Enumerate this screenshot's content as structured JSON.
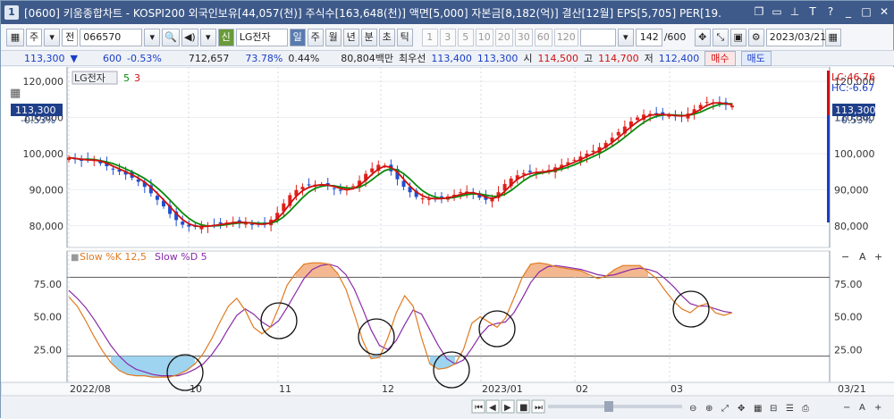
{
  "window": {
    "number": "1",
    "title": "[0600] 키움종합차트 - KOSPI200 외국인보유[44,057(천)] 주식수[163,648(천)] 액면[5,000] 자본금[8,182(억)] 결산[12월] EPS[5,705] PER[19.",
    "icons": [
      "restore-icon",
      "minimize-icon",
      "pin-icon",
      "text-icon",
      "help-icon",
      "min-icon",
      "max-icon",
      "close-icon"
    ]
  },
  "toolbar": {
    "period": "주",
    "before": "전",
    "code": "066570",
    "stock_kind": "신",
    "stock_name": "LG전자",
    "timeframes": [
      "일",
      "주",
      "월",
      "년",
      "분",
      "초",
      "틱"
    ],
    "active_timeframe": "일",
    "intervals": [
      "1",
      "3",
      "5",
      "10",
      "20",
      "30",
      "60",
      "120"
    ],
    "count": "142",
    "count_total": "/600",
    "date": "2023/03/21"
  },
  "quote": {
    "price": "113,300",
    "change": "600",
    "change_rate": "-0.53%",
    "volume": "712,657",
    "volume_rate": "73.78%",
    "turnover": "0.44%",
    "amount": "80,804백만",
    "best_label": "최우선",
    "best_ask": "113,400",
    "best_bid": "113,300",
    "open_label": "시",
    "open": "114,500",
    "high_label": "고",
    "high": "114,700",
    "low_label": "저",
    "low": "112,400",
    "buy_label": "매수",
    "sell_label": "매도"
  },
  "price_panel": {
    "legend_name": "LG전자",
    "ma_periods": [
      "5",
      "3"
    ],
    "current_price": "113,300",
    "current_rate": "-0.53%",
    "lc_label": "LC:46.76",
    "hc_label": "HC:-6.67"
  },
  "stoch_panel": {
    "legend_k": "Slow %K 12,5",
    "legend_d": "Slow %D 5"
  },
  "chart_data": [
    {
      "type": "candlestick",
      "title": "",
      "ylim": [
        74000,
        124000
      ],
      "yticks": [
        "80,000",
        "90,000",
        "100,000",
        "110,000",
        "120,000"
      ],
      "close": [
        98900,
        98400,
        98000,
        98400,
        98200,
        97300,
        96500,
        95800,
        95000,
        94200,
        93300,
        92200,
        90800,
        89000,
        87200,
        85400,
        83300,
        81600,
        80300,
        79800,
        79700,
        79900,
        80100,
        80300,
        80600,
        80900,
        81100,
        81000,
        80700,
        80400,
        80300,
        80600,
        81700,
        83600,
        86200,
        88500,
        89900,
        90800,
        91300,
        91400,
        91400,
        91100,
        90200,
        89700,
        90100,
        91000,
        92500,
        94400,
        95900,
        96900,
        96700,
        95100,
        92900,
        90800,
        89300,
        88000,
        87600,
        87400,
        87500,
        87700,
        88100,
        88600,
        89300,
        89500,
        88800,
        87800,
        87200,
        87700,
        89300,
        91600,
        93100,
        94000,
        94600,
        94900,
        94900,
        95000,
        95500,
        96200,
        96900,
        97600,
        98300,
        99200,
        100000,
        100800,
        101800,
        103000,
        104400,
        106000,
        107500,
        108900,
        110000,
        110800,
        111000,
        110800,
        110700,
        110600,
        110300,
        110400,
        111100,
        112300,
        113500,
        114300,
        114200,
        113800,
        113500,
        113300
      ],
      "ma_fast_name": "5",
      "ma_slow_name": "3"
    },
    {
      "type": "line",
      "title": "",
      "ylim": [
        0,
        100
      ],
      "yticks": [
        "25.00",
        "50.00",
        "75.00"
      ],
      "reference_lines": [
        80,
        20
      ],
      "series": [
        {
          "name": "Slow %K 12,5",
          "color": "#e07a1f",
          "values": [
            65,
            58,
            47,
            35,
            24,
            15,
            9,
            6,
            5,
            5,
            4,
            4,
            4,
            6,
            9,
            14,
            22,
            33,
            46,
            58,
            64,
            55,
            42,
            37,
            42,
            57,
            74,
            83,
            90,
            91,
            91,
            90,
            83,
            71,
            52,
            32,
            18,
            19,
            34,
            53,
            66,
            58,
            34,
            14,
            10,
            11,
            14,
            25,
            45,
            50,
            46,
            42,
            49,
            64,
            80,
            90,
            91,
            90,
            88,
            87,
            86,
            85,
            82,
            79,
            81,
            86,
            89,
            89,
            89,
            84,
            79,
            70,
            62,
            56,
            53,
            58,
            60,
            53,
            51,
            53
          ]
        },
        {
          "name": "Slow %D 5",
          "color": "#8a2aa8",
          "values": [
            70,
            64,
            57,
            48,
            38,
            28,
            20,
            14,
            10,
            8,
            6,
            5,
            5,
            5,
            7,
            10,
            14,
            21,
            30,
            41,
            51,
            56,
            52,
            46,
            42,
            47,
            57,
            68,
            79,
            86,
            89,
            90,
            88,
            82,
            71,
            56,
            40,
            28,
            25,
            32,
            44,
            55,
            52,
            40,
            28,
            18,
            14,
            17,
            26,
            36,
            43,
            45,
            46,
            53,
            64,
            76,
            84,
            88,
            89,
            88,
            87,
            86,
            84,
            82,
            81,
            82,
            84,
            86,
            87,
            86,
            84,
            79,
            73,
            66,
            60,
            58,
            58,
            56,
            54,
            53
          ]
        }
      ]
    }
  ],
  "x_axis": {
    "labels": [
      "2022/08",
      "10",
      "11",
      "12",
      "2023/01",
      "02",
      "03",
      "03/21"
    ]
  }
}
